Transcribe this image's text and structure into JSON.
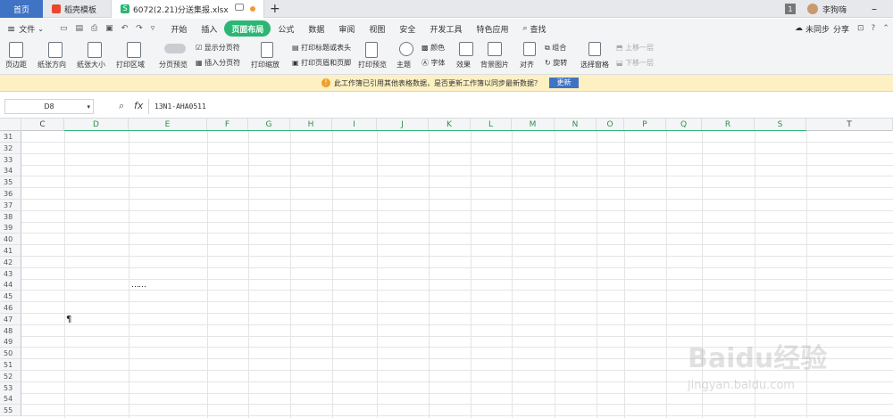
{
  "tabs": {
    "home": "首页",
    "daoke": "稻壳模板",
    "file": "6072(2.21)分送集报.xlsx",
    "add": "+"
  },
  "titlebar": {
    "badge": "1",
    "user": "李狗嗨",
    "minimize": "–"
  },
  "menu": {
    "file": "文件",
    "items": [
      "开始",
      "插入",
      "页面布局",
      "公式",
      "数据",
      "审阅",
      "视图",
      "安全",
      "开发工具",
      "特色应用",
      "查找"
    ],
    "active": "页面布局",
    "right": [
      "未同步",
      "分享"
    ]
  },
  "ribbon": {
    "margin": "页边距",
    "orientation": "纸张方向",
    "size": "纸张大小",
    "print_area": "打印区域",
    "page_break_preview": "分页预览",
    "show_page_breaks": "显示分页符",
    "insert_page_break": "插入分页符",
    "print_scale": "打印缩放",
    "print_titles": "打印标题或表头",
    "header_footer": "打印页眉和页脚",
    "print_preview": "打印预览",
    "theme": "主题",
    "colors": "颜色",
    "fonts": "字体",
    "effects": "效果",
    "background": "背景图片",
    "align": "对齐",
    "group": "组合",
    "rotate": "旋转",
    "selection_pane": "选择窗格",
    "bring_forward": "上移一层",
    "send_backward": "下移一层"
  },
  "notice": {
    "text": "此工作簿已引用其他表格数据，是否更新工作簿以同步最新数据？",
    "button": "更新"
  },
  "formula": {
    "cell": "D8",
    "fx": "fx",
    "value": "13N1-AHA0511"
  },
  "columns": [
    "C",
    "D",
    "E",
    "F",
    "G",
    "H",
    "I",
    "J",
    "K",
    "L",
    "M",
    "N",
    "O",
    "P",
    "Q",
    "R",
    "S",
    "T"
  ],
  "rows": [
    "31",
    "32",
    "33",
    "34",
    "35",
    "36",
    "37",
    "38",
    "39",
    "40",
    "41",
    "42",
    "43",
    "44",
    "45",
    "46",
    "47",
    "48",
    "49",
    "50",
    "51",
    "52",
    "53",
    "54",
    "55"
  ],
  "cells": {
    "e44": "……",
    "d47": "¶"
  },
  "watermark": {
    "brand": "Baidu经验",
    "url": "jingyan.baidu.com"
  },
  "colors": {
    "accent": "#2bb673",
    "home_tab": "#3f73c4",
    "notice_bg": "#fdf0c2",
    "update_btn": "#3f73c4"
  }
}
